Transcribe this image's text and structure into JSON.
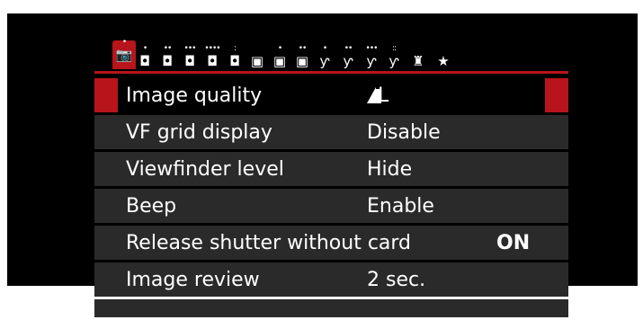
{
  "tabs": [
    {
      "icon": "camera-icon",
      "glyph": "📷",
      "dots": "•",
      "active": true
    },
    {
      "icon": "camera-icon",
      "glyph": "◘",
      "dots": "•"
    },
    {
      "icon": "camera-icon",
      "glyph": "◘",
      "dots": "••"
    },
    {
      "icon": "camera-icon",
      "glyph": "◘",
      "dots": "•••"
    },
    {
      "icon": "camera-icon",
      "glyph": "◘",
      "dots": "••••"
    },
    {
      "icon": "camera-icon",
      "glyph": "◘",
      "dots": ":"
    },
    {
      "icon": "playback-icon",
      "glyph": "▣",
      "dots": ""
    },
    {
      "icon": "playback-icon",
      "glyph": "▣",
      "dots": "•"
    },
    {
      "icon": "playback-icon",
      "glyph": "▣",
      "dots": "••"
    },
    {
      "icon": "wrench-icon",
      "glyph": "ƴ",
      "dots": "•"
    },
    {
      "icon": "wrench-icon",
      "glyph": "ƴ",
      "dots": "••"
    },
    {
      "icon": "wrench-icon",
      "glyph": "ƴ",
      "dots": "•••"
    },
    {
      "icon": "wrench-icon",
      "glyph": "ƴ",
      "dots": "::"
    },
    {
      "icon": "custom-functions-icon",
      "glyph": "♜",
      "dots": ""
    },
    {
      "icon": "star-icon",
      "glyph": "★",
      "dots": ""
    }
  ],
  "rows": [
    {
      "label": "Image quality",
      "value": "L",
      "value_icon": "quality-fine-icon",
      "selected": true
    },
    {
      "label": "VF grid display",
      "value": "Disable"
    },
    {
      "label": "Viewfinder level",
      "value": "Hide"
    },
    {
      "label": "Beep",
      "value": "Enable"
    },
    {
      "label": "Release shutter without card",
      "value": "ON",
      "far": true
    },
    {
      "label": "Image review",
      "value": "2 sec."
    }
  ],
  "colors": {
    "accent": "#b8141b",
    "row_bg": "#2a2a2a",
    "screen_bg": "#000000"
  }
}
